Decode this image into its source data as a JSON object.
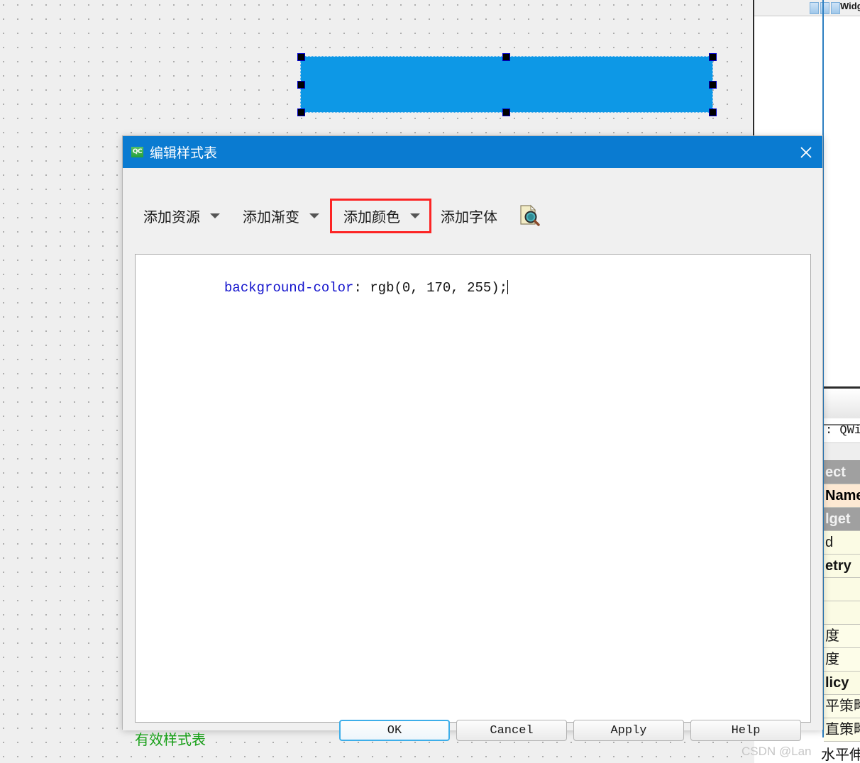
{
  "canvas": {
    "selected_widget": {
      "name": "widget",
      "background_color": "rgb(0, 170, 255)",
      "hex": "#0d98e6"
    },
    "grid_dot_color": "#a8a8a8",
    "background_color": "#efefef"
  },
  "right_panel": {
    "toolbar_text": "Widg",
    "icons": [
      "panel-icon-1",
      "panel-icon-2",
      "panel-icon-3"
    ],
    "object_type_line": ": QWid",
    "property_rows": [
      {
        "text": "ect",
        "style": "header"
      },
      {
        "text": "Name",
        "style": "highlight"
      },
      {
        "text": "lget",
        "style": "header"
      },
      {
        "text": "d",
        "style": "value"
      },
      {
        "text": "etry",
        "style": "value-bold"
      },
      {
        "text": "",
        "style": "empty"
      },
      {
        "text": "",
        "style": "empty"
      },
      {
        "text": "度",
        "style": "plain"
      },
      {
        "text": "度",
        "style": "plain"
      },
      {
        "text": "licy",
        "style": "value-bold"
      },
      {
        "text": "平策略",
        "style": "plain"
      },
      {
        "text": "直策略",
        "style": "plain"
      }
    ]
  },
  "watermark": "CSDN @Lan",
  "stretch_label": "水平伸展",
  "dialog": {
    "app_icon": "qt-creator-icon",
    "title": "编辑样式表",
    "close_label": "close-icon",
    "titlebar_color": "#0a7bd1",
    "toolbar": [
      {
        "label": "添加资源",
        "has_arrow": true,
        "boxed": false
      },
      {
        "label": "添加渐变",
        "has_arrow": true,
        "boxed": false
      },
      {
        "label": "添加颜色",
        "has_arrow": true,
        "boxed": true
      },
      {
        "label": "添加字体",
        "has_arrow": false,
        "boxed": false
      }
    ],
    "highlight_box_color": "#fc2424",
    "preview_icon": "document-magnifier-icon",
    "editor": {
      "code_property": "background-color",
      "code_value": ": rgb(0, 170, 255);",
      "property_color": "#1111cc",
      "value_color": "#111111"
    },
    "footer": {
      "valid_text": "有效样式表",
      "valid_color": "#18a018",
      "buttons": [
        {
          "label": "OK",
          "focused": true
        },
        {
          "label": "Cancel",
          "focused": false
        },
        {
          "label": "Apply",
          "focused": false
        },
        {
          "label": "Help",
          "focused": false
        }
      ]
    }
  }
}
